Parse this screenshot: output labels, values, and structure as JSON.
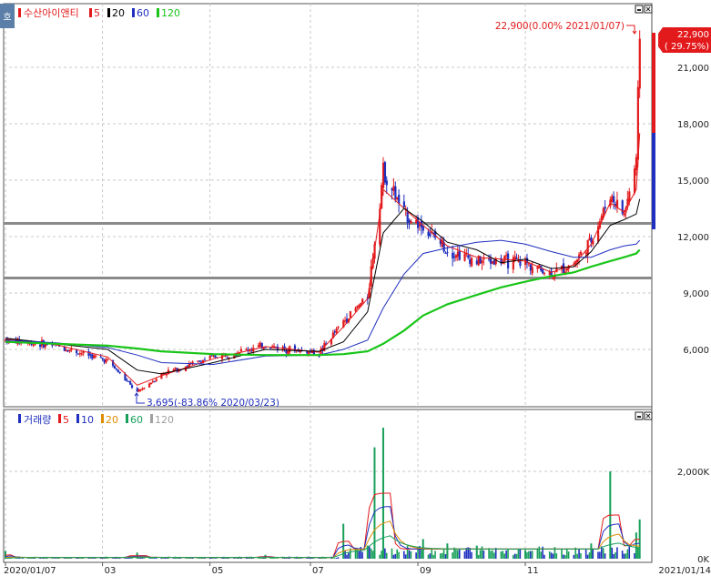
{
  "price_panel": {
    "stock_name": "수산아이앤티",
    "ma_legend": [
      {
        "label": "5",
        "color": "#e31a1c"
      },
      {
        "label": "20",
        "color": "#000000"
      },
      {
        "label": "60",
        "color": "#1f2fbf"
      },
      {
        "label": "120",
        "color": "#19c519"
      }
    ],
    "toggle_badge": "호",
    "last_annotation": "22,900(0.00% 2021/01/07)",
    "low_annotation": "3,695(-83.86% 2020/03/23)",
    "current_price": "22,900",
    "current_change": "( 29.75%)",
    "y_ticks": [
      "21,000",
      "18,000",
      "15,000",
      "12,000",
      "9,000",
      "6,000"
    ]
  },
  "volume_panel": {
    "title": "거래량",
    "ma_legend": [
      {
        "label": "5",
        "color": "#e31a1c"
      },
      {
        "label": "10",
        "color": "#1f2fbf"
      },
      {
        "label": "20",
        "color": "#e08a00"
      },
      {
        "label": "60",
        "color": "#17a05a"
      },
      {
        "label": "120",
        "color": "#a0a0a0"
      }
    ],
    "y_ticks": [
      "2,000K",
      "0K"
    ]
  },
  "x_axis": {
    "ticks": [
      "2020/01/07",
      "03",
      "05",
      "07",
      "09",
      "11"
    ],
    "end_label": "2021/01/14"
  },
  "chart_data": [
    {
      "type": "line",
      "title": "수산아이앤티",
      "subtitle": "",
      "xlabel": "",
      "ylabel": "",
      "x_range": [
        "2020/01/07",
        "2021/01/14"
      ],
      "ylim": [
        3500,
        23000
      ],
      "grid": true,
      "horizontal_lines": [
        12700,
        9800
      ],
      "x": [
        "2020-01-07",
        "2020-02-05",
        "2020-03-06",
        "2020-03-23",
        "2020-04-06",
        "2020-05-06",
        "2020-06-05",
        "2020-07-06",
        "2020-07-20",
        "2020-08-03",
        "2020-08-12",
        "2020-08-24",
        "2020-09-04",
        "2020-09-18",
        "2020-10-05",
        "2020-10-19",
        "2020-11-02",
        "2020-11-17",
        "2020-11-30",
        "2020-12-10",
        "2020-12-21",
        "2020-12-29",
        "2021-01-05",
        "2021-01-07"
      ],
      "series": [
        {
          "name": "close",
          "values": [
            6500,
            6200,
            5400,
            3695,
            4700,
            5600,
            6200,
            5800,
            7500,
            8800,
            15500,
            13200,
            12500,
            11300,
            10700,
            10700,
            10600,
            10000,
            10600,
            11800,
            14200,
            13200,
            16000,
            22900
          ]
        },
        {
          "name": "5",
          "values": [
            6550,
            6250,
            5600,
            4100,
            4600,
            5500,
            6150,
            5850,
            7200,
            8700,
            14500,
            13500,
            12600,
            11500,
            10900,
            10800,
            10700,
            10100,
            10500,
            11600,
            13800,
            13300,
            14500,
            17500
          ]
        },
        {
          "name": "20",
          "values": [
            6600,
            6300,
            6000,
            4900,
            4700,
            5300,
            6000,
            5900,
            6400,
            8000,
            12200,
            13500,
            12800,
            11700,
            11300,
            10600,
            10800,
            10300,
            10400,
            11200,
            12600,
            12900,
            13200,
            14000
          ]
        },
        {
          "name": "60",
          "values": [
            6500,
            6350,
            6100,
            5700,
            5300,
            5200,
            5650,
            5700,
            6000,
            6500,
            8200,
            10000,
            11100,
            11400,
            11700,
            11800,
            11600,
            11200,
            10900,
            10900,
            11300,
            11500,
            11600,
            11800
          ]
        },
        {
          "name": "120",
          "values": [
            6400,
            6300,
            6200,
            6050,
            5900,
            5750,
            5700,
            5700,
            5750,
            5900,
            6300,
            7000,
            7800,
            8400,
            8900,
            9300,
            9600,
            9900,
            10100,
            10400,
            10700,
            10900,
            11100,
            11300
          ]
        }
      ]
    },
    {
      "type": "bar",
      "title": "거래량",
      "xlabel": "",
      "ylabel": "",
      "ylim": [
        0,
        3000
      ],
      "unit": "K",
      "categories": [
        "2020-01-07",
        "2020-03-23",
        "2020-06-05",
        "2020-07-20",
        "2020-08-03",
        "2020-08-07",
        "2020-08-12",
        "2020-09-04",
        "2020-09-18",
        "2020-10-05",
        "2020-11-02",
        "2020-12-10",
        "2020-12-21",
        "2021-01-05",
        "2021-01-07"
      ],
      "values": [
        180,
        140,
        90,
        800,
        300,
        2550,
        3000,
        450,
        350,
        300,
        200,
        350,
        2000,
        600,
        900
      ]
    }
  ]
}
